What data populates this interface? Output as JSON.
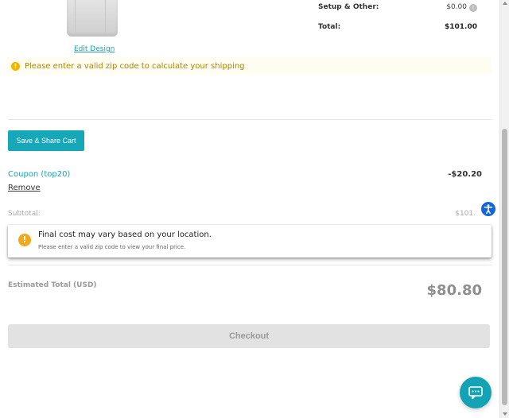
{
  "product": {
    "edit_design_label": "Edit Design"
  },
  "summary": {
    "setup_label": "Setup & Other:",
    "setup_value": "$0.00",
    "total_label": "Total:",
    "total_value": "$101.00"
  },
  "shipping_warning": {
    "icon": "warning-icon",
    "text": "Please enter a valid zip code to calculate your shipping"
  },
  "cart": {
    "save_share_label": "Save & Share Cart",
    "coupon_label": "Coupon (top20)",
    "coupon_amount": "-$20.20",
    "remove_label": "Remove",
    "subtotal_label": "Subtotal:",
    "subtotal_value": "$101."
  },
  "final_cost_notice": {
    "icon": "warning-icon",
    "title": "Final cost may vary based on your location.",
    "subtitle": "Please enter a valid zip code to view your final price."
  },
  "estimated_total": {
    "label": "Estimated Total (USD)",
    "value": "$80.80"
  },
  "checkout": {
    "label": "Checkout"
  },
  "colors": {
    "accent": "#16a7b8",
    "link": "#1a9fb2",
    "warning": "#f2b400",
    "accessibility": "#1565d8"
  }
}
